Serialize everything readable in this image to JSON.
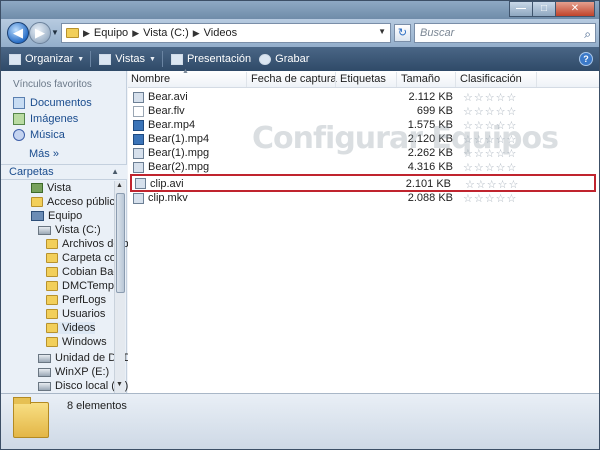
{
  "window": {
    "caption_buttons": [
      "—",
      "□",
      "✕"
    ]
  },
  "address": {
    "crumbs": [
      "Equipo",
      "Vista (C:)",
      "Videos"
    ],
    "search_placeholder": "Buscar"
  },
  "toolbar": {
    "organize": "Organizar",
    "views": "Vistas",
    "slideshow": "Presentación",
    "burn": "Grabar",
    "help": "?"
  },
  "sidebar": {
    "favorites_title": "Vínculos favoritos",
    "favorites": [
      "Documentos",
      "Imágenes",
      "Música"
    ],
    "more": "Más",
    "more_arrows": "»",
    "folders_title": "Carpetas",
    "tree": [
      "Vista",
      "Acceso público",
      "Equipo",
      "Vista (C:)",
      "Archivos de p",
      "Carpeta com",
      "Cobian Back",
      "DMCTemp",
      "PerfLogs",
      "Usuarios",
      "Videos",
      "Windows",
      "Unidad de DVD",
      "WinXP (E:)",
      "Disco local (F:)"
    ]
  },
  "columns": {
    "name": "Nombre",
    "date": "Fecha de captura",
    "tags": "Etiquetas",
    "size": "Tamaño",
    "rating": "Clasificación"
  },
  "files": [
    {
      "name": "Bear.avi",
      "size": "2.112 KB",
      "rating": "☆☆☆☆☆"
    },
    {
      "name": "Bear.flv",
      "size": "699 KB",
      "rating": "☆☆☆☆☆"
    },
    {
      "name": "Bear.mp4",
      "size": "1.575 KB",
      "rating": "☆☆☆☆☆"
    },
    {
      "name": "Bear(1).mp4",
      "size": "2.120 KB",
      "rating": "☆☆☆☆☆"
    },
    {
      "name": "Bear(1).mpg",
      "size": "2.262 KB",
      "rating": "☆☆☆☆☆"
    },
    {
      "name": "Bear(2).mpg",
      "size": "4.316 KB",
      "rating": "☆☆☆☆☆"
    },
    {
      "name": "clip.avi",
      "size": "2.101 KB",
      "rating": "☆☆☆☆☆"
    },
    {
      "name": "clip.mkv",
      "size": "2.088 KB",
      "rating": "☆☆☆☆☆"
    }
  ],
  "watermark": "Configurar Equipos",
  "details": {
    "count": "8 elementos"
  },
  "colors": {
    "highlight_border": "#c0242e",
    "toolbar_bg": "#2f4a68",
    "link_color": "#1a4c8e"
  }
}
